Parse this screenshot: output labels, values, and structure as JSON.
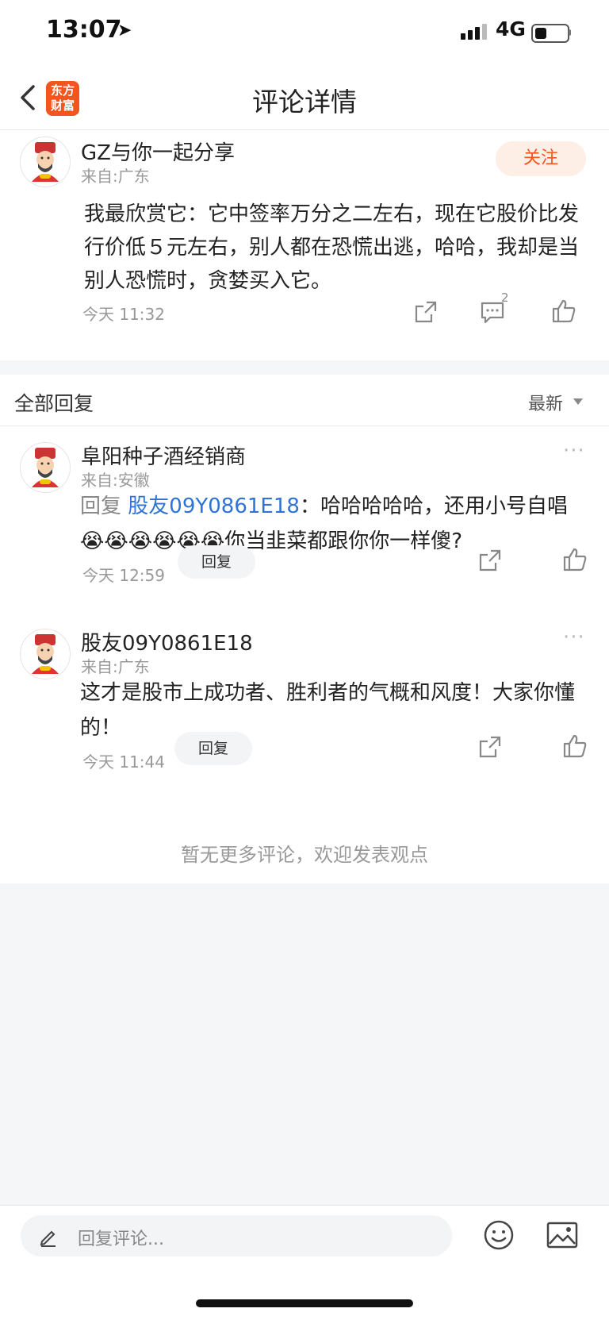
{
  "status": {
    "time": "13:07",
    "network": "4G"
  },
  "nav": {
    "logo_text": "东方财富",
    "title": "评论详情"
  },
  "main_comment": {
    "user": "GZ与你一起分享",
    "from": "来自:广东",
    "follow_label": "关注",
    "text": "我最欣赏它：它中签率万分之二左右，现在它股价比发行价低５元左右，别人都在恐慌出逃，哈哈，我却是当别人恐慌时，贪婪买入它。",
    "time": "今天 11:32",
    "comment_count": "2"
  },
  "replies_header": {
    "label": "全部回复",
    "sort": "最新"
  },
  "replies": [
    {
      "user": "阜阳种子酒经销商",
      "from": "来自:安徽",
      "prefix": "回复",
      "mention": "股友09Y0861E18",
      "colon": "：",
      "text": "哈哈哈哈哈，还用小号自唱😭😭😭😭😭😭你当韭菜都跟你你一样傻?",
      "time": "今天 12:59",
      "reply_label": "回复",
      "more": "···"
    },
    {
      "user": "股友09Y0861E18",
      "from": "来自:广东",
      "text": "这才是股市上成功者、胜利者的气概和风度！大家你懂的！",
      "time": "今天 11:44",
      "reply_label": "回复",
      "more": "···"
    }
  ],
  "end_note": "暂无更多评论，欢迎发表观点",
  "bottom_bar": {
    "placeholder": "回复评论..."
  },
  "colors": {
    "brand": "#f4551f",
    "mention": "#2f73d6"
  }
}
